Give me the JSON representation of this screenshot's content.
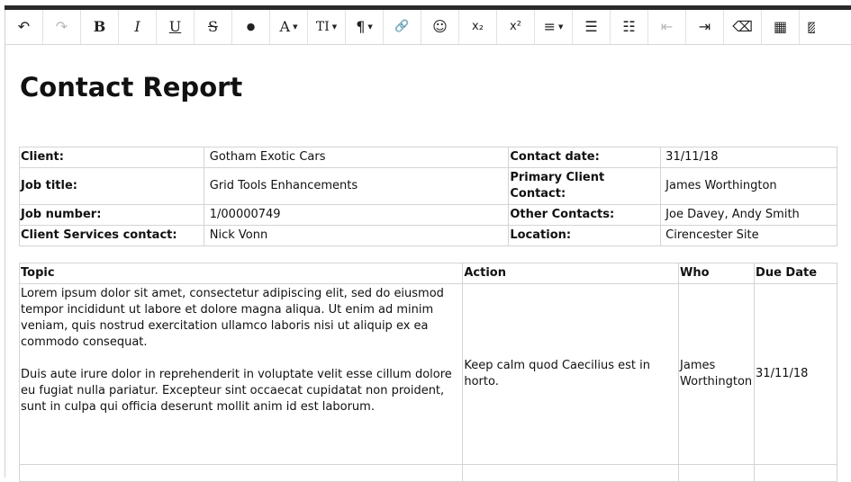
{
  "toolbar": {
    "buttons": [
      {
        "icon": "undo-icon",
        "glyph": "↶",
        "disabled": false
      },
      {
        "icon": "redo-icon",
        "glyph": "↷",
        "disabled": true
      },
      {
        "icon": "bold-icon",
        "glyph": "B"
      },
      {
        "icon": "italic-icon",
        "glyph": "I"
      },
      {
        "icon": "underline-icon",
        "glyph": "U"
      },
      {
        "icon": "strikethrough-icon",
        "glyph": "S"
      },
      {
        "icon": "color-drop-icon",
        "glyph": "●"
      },
      {
        "icon": "font-family-icon",
        "glyph": "A"
      },
      {
        "icon": "font-size-icon",
        "glyph": "TI"
      },
      {
        "icon": "paragraph-format-icon",
        "glyph": "¶"
      },
      {
        "icon": "link-icon",
        "glyph": "🔗"
      },
      {
        "icon": "emoji-icon",
        "glyph": "☺"
      },
      {
        "icon": "subscript-icon",
        "glyph": "x₂"
      },
      {
        "icon": "superscript-icon",
        "glyph": "x²"
      },
      {
        "icon": "align-icon",
        "glyph": "≡"
      },
      {
        "icon": "ordered-list-icon",
        "glyph": "☰"
      },
      {
        "icon": "unordered-list-icon",
        "glyph": "☷"
      },
      {
        "icon": "outdent-icon",
        "glyph": "⇤"
      },
      {
        "icon": "indent-icon",
        "glyph": "⇥"
      },
      {
        "icon": "clear-format-icon",
        "glyph": "⌫"
      },
      {
        "icon": "table-icon",
        "glyph": "▦"
      },
      {
        "icon": "image-icon",
        "glyph": "▨"
      }
    ]
  },
  "document": {
    "title": "Contact Report",
    "info": {
      "client_label": "Client:",
      "client_value": "Gotham Exotic Cars",
      "contact_date_label": "Contact date:",
      "contact_date_value": "31/11/18",
      "job_title_label": "Job title:",
      "job_title_value": "Grid Tools Enhancements",
      "primary_contact_label": "Primary Client Contact:",
      "primary_contact_value": "James Worthington",
      "job_number_label": "Job number:",
      "job_number_value": "1/00000749",
      "other_contacts_label": "Other Contacts:",
      "other_contacts_value": "Joe Davey, Andy Smith",
      "client_services_label": "Client Services contact:",
      "client_services_value": "Nick Vonn",
      "location_label": "Location:",
      "location_value": "Cirencester Site"
    },
    "actions": {
      "headers": {
        "topic": "Topic",
        "action": "Action",
        "who": "Who",
        "due": "Due Date"
      },
      "rows": [
        {
          "topic_p1": "Lorem ipsum dolor sit amet, consectetur adipiscing elit, sed do eiusmod tempor incididunt ut labore et dolore magna aliqua. Ut enim ad minim veniam, quis nostrud exercitation ullamco laboris nisi ut aliquip ex ea commodo consequat.",
          "topic_p2": "Duis aute irure dolor in reprehenderit in voluptate velit esse cillum dolore eu fugiat nulla pariatur. Excepteur sint occaecat cupidatat non proident, sunt in culpa qui officia deserunt mollit anim id est laborum.",
          "action": "Keep calm quod Caecilius est in horto.",
          "who": "James Worthington",
          "due": "31/11/18"
        }
      ]
    }
  }
}
